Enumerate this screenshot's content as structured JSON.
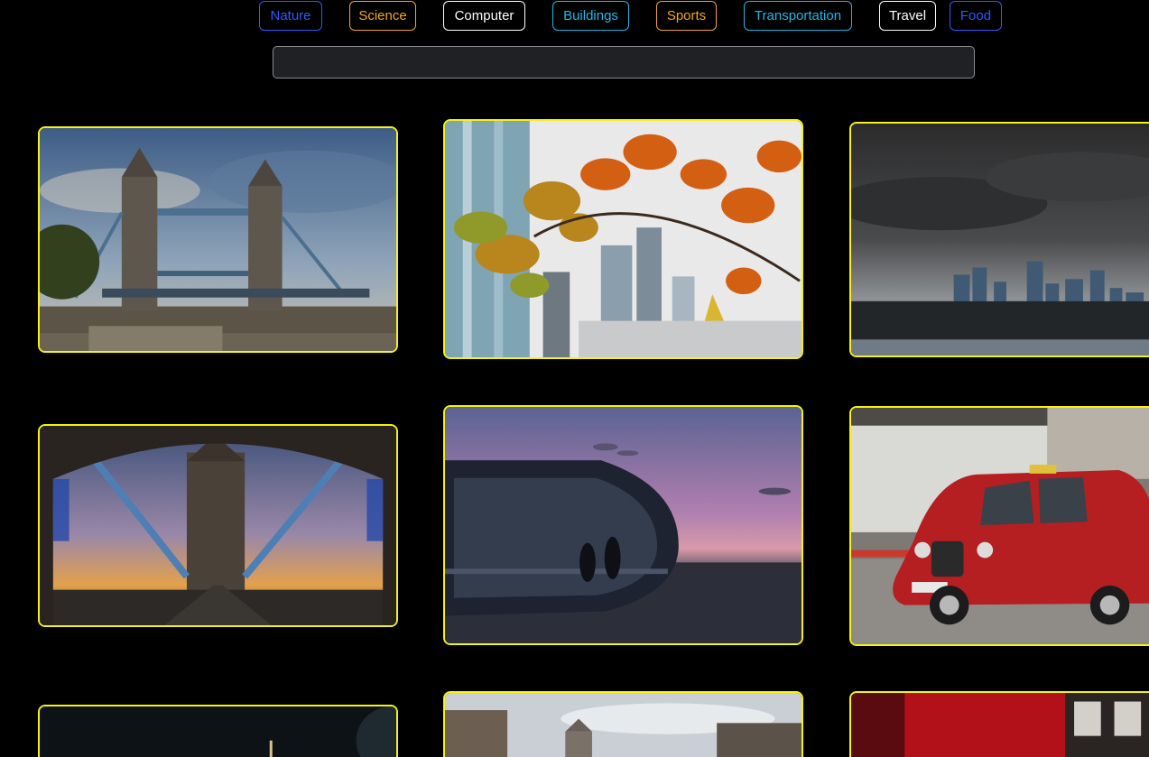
{
  "categories": [
    {
      "label": "Nature",
      "color": "#2d5bff"
    },
    {
      "label": "Science",
      "color": "#f5a623"
    },
    {
      "label": "Computer",
      "color": "#ffffff"
    },
    {
      "label": "Buildings",
      "color": "#22b8e6"
    },
    {
      "label": "Sports",
      "color": "#f5a623"
    },
    {
      "label": "Transportation",
      "color": "#22b8e6"
    },
    {
      "label": "Travel",
      "color": "#ffffff"
    },
    {
      "label": "Food",
      "color": "#2d5bff"
    }
  ],
  "search": {
    "value": "",
    "placeholder": ""
  },
  "gallery": {
    "card_border_color": "#f5f214",
    "photos": [
      {
        "subject": "tower-bridge-day"
      },
      {
        "subject": "autumn-leaves-city"
      },
      {
        "subject": "stormy-skyline"
      },
      {
        "subject": "tower-bridge-sunset-arch"
      },
      {
        "subject": "london-eye-capsule-dusk"
      },
      {
        "subject": "red-london-taxi"
      },
      {
        "subject": "night-city-moon"
      },
      {
        "subject": "tower-bridge-street"
      },
      {
        "subject": "red-bus-blur"
      }
    ]
  }
}
